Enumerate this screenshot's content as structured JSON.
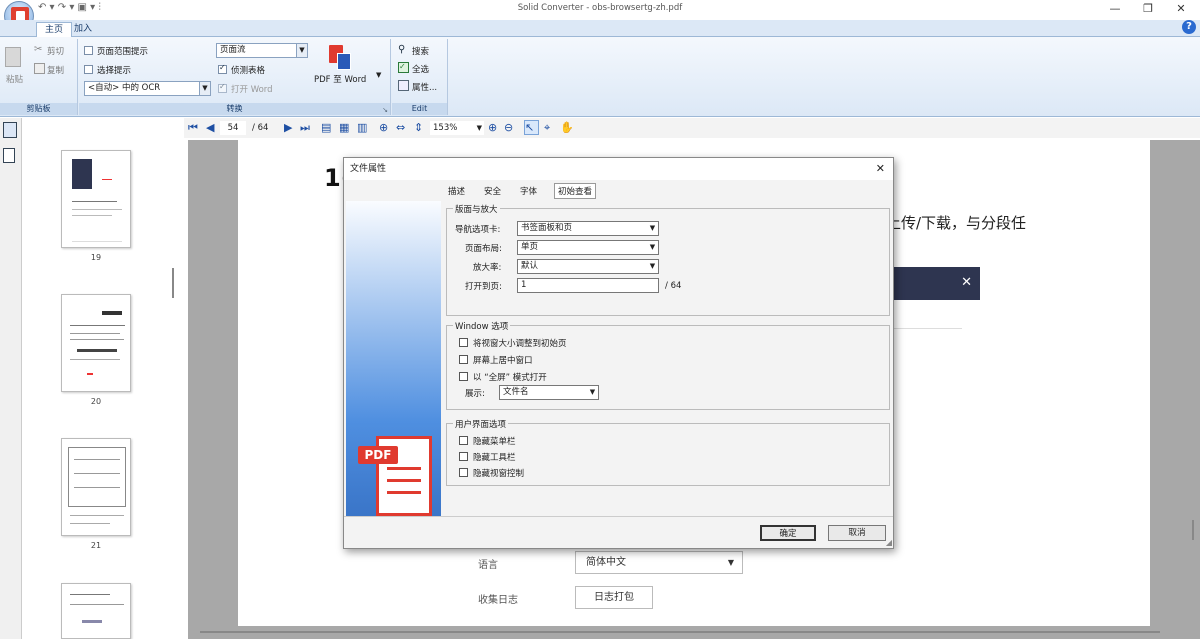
{
  "window": {
    "title": "Solid Converter - obs-browsertg-zh.pdf",
    "minimize": "—",
    "restore": "❐",
    "close": "✕",
    "help": "?"
  },
  "ribbon": {
    "tabs": [
      "主页",
      "加入"
    ],
    "clipboard": {
      "paste": "粘贴",
      "cut": "剪切",
      "copy": "复制",
      "label": "剪贴板"
    },
    "convert": {
      "page_range_hint": "页面范围提示",
      "select_hint": "选择提示",
      "ocr_value": "<自动> 中的 OCR",
      "flow_value": "页面流",
      "detect_tables": "侦测表格",
      "open_word": "打开 Word",
      "pdf_to_word": "PDF 至 Word",
      "label": "转换"
    },
    "edit": {
      "search": "搜索",
      "select_all": "全选",
      "properties": "属性...",
      "label": "Edit"
    }
  },
  "toolbar": {
    "current_page": "54",
    "total_pages": "/ 64",
    "zoom": "153%"
  },
  "thumbnails": [
    {
      "num": "19"
    },
    {
      "num": "20"
    },
    {
      "num": "21"
    }
  ],
  "document": {
    "heading_fragment": "1(",
    "text_fragment": "上传/下载，与分段任",
    "banner_close": "✕",
    "language_label": "语言",
    "language_value": "简体中文",
    "log_label": "收集日志",
    "log_button": "日志打包"
  },
  "dialog": {
    "title": "文件属性",
    "close": "✕",
    "tabs": [
      "描述",
      "安全",
      "字体",
      "初始查看"
    ],
    "layout_group": {
      "legend": "版面与放大",
      "nav_label": "导航选项卡:",
      "nav_value": "书签面板和页",
      "layout_label": "页面布局:",
      "layout_value": "单页",
      "zoom_label": "放大率:",
      "zoom_value": "默认",
      "open_label": "打开到页:",
      "open_value": "1",
      "open_total": "/ 64"
    },
    "window_group": {
      "legend": "Window 选项",
      "opt1": "将视窗大小调整到初始页",
      "opt2": "屏幕上居中窗口",
      "opt3": "以 “全屏” 模式打开",
      "show_label": "展示:",
      "show_value": "文件名"
    },
    "ui_group": {
      "legend": "用户界面选项",
      "opt1": "隐藏菜单栏",
      "opt2": "隐藏工具栏",
      "opt3": "隐藏视窗控制"
    },
    "ok": "确定",
    "cancel": "取消",
    "logo_text": "PDF"
  },
  "colors": {
    "ribbon": "#dce8f6",
    "accent": "#1e4fa3",
    "pdf_red": "#e03a2f",
    "banner": "#2e3550"
  }
}
